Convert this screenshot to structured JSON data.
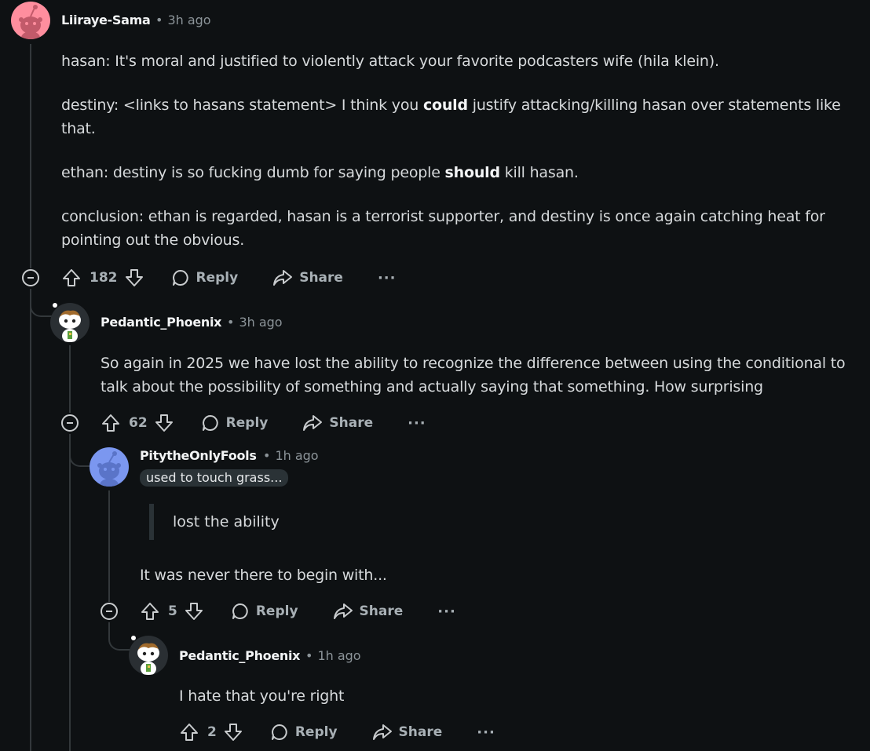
{
  "comments": [
    {
      "author": "Liiraye-Sama",
      "time": "3h ago",
      "paragraphs": [
        [
          "hasan: It's moral and justified to violently attack your favorite podcasters wife (hila klein)."
        ],
        [
          "destiny: <links to hasans statement> I think you ",
          "could",
          " justify attacking/killing hasan over statements like that."
        ],
        [
          "ethan: destiny is so fucking dumb for saying people ",
          "should",
          " kill hasan."
        ],
        [
          "conclusion: ethan is regarded, hasan is a terrorist supporter, and destiny is once again catching heat for pointing out the obvious."
        ]
      ],
      "votes": "182"
    },
    {
      "author": "Pedantic_Phoenix",
      "time": "3h ago",
      "text": "So again in 2025 we have lost the ability to recognize the difference between using the conditional to talk about the possibility of something and actually saying that something. How surprising",
      "votes": "62"
    },
    {
      "author": "PitytheOnlyFools",
      "time": "1h ago",
      "flair": "used to touch grass...",
      "quote": "lost the ability",
      "text": "It was never there to begin with...",
      "votes": "5"
    },
    {
      "author": "Pedantic_Phoenix",
      "time": "1h ago",
      "text": "I hate that you're right",
      "votes": "2"
    }
  ],
  "actions": {
    "reply": "Reply",
    "share": "Share",
    "more": "···"
  },
  "meta_separator": "•",
  "colors": {
    "background": "#0e1113",
    "text": "#d7dadc",
    "muted": "#8c9499",
    "line": "#33383b"
  }
}
